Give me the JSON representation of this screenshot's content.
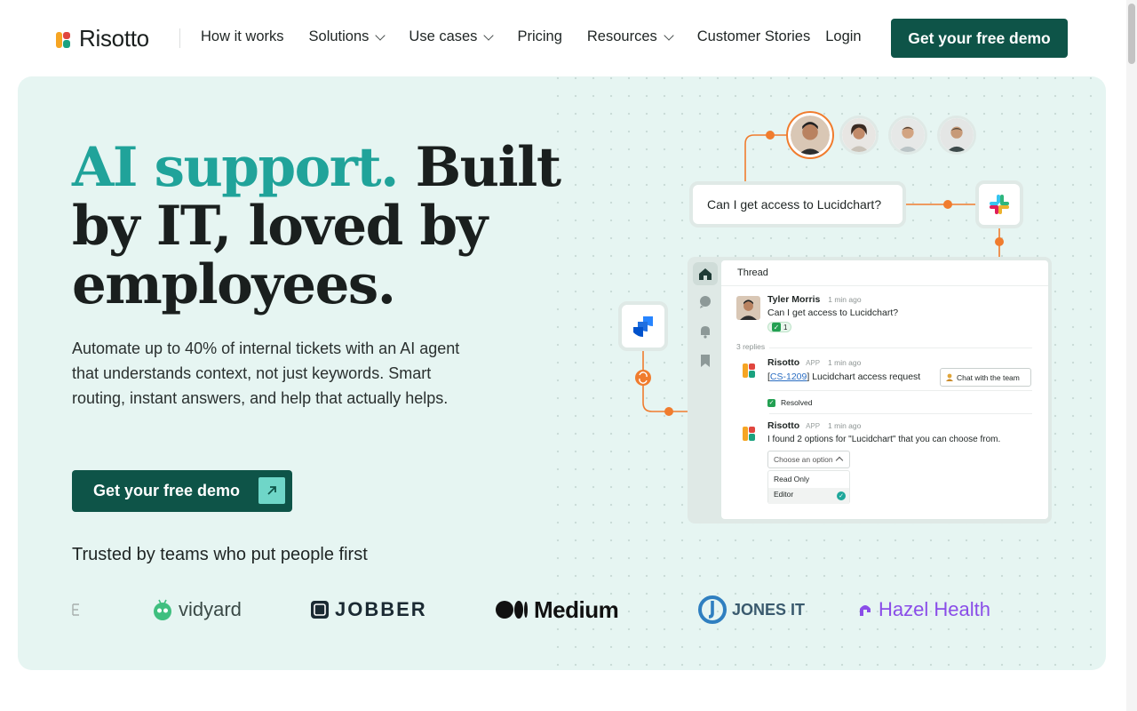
{
  "brand": {
    "name": "Risotto"
  },
  "nav": {
    "links": [
      {
        "label": "How it works",
        "dropdown": false
      },
      {
        "label": "Solutions",
        "dropdown": true
      },
      {
        "label": "Use cases",
        "dropdown": true
      },
      {
        "label": "Pricing",
        "dropdown": false
      },
      {
        "label": "Resources",
        "dropdown": true
      },
      {
        "label": "Customer Stories",
        "dropdown": false
      }
    ],
    "login": "Login",
    "cta": "Get your free demo"
  },
  "hero": {
    "headline_accent": "AI support.",
    "headline_rest": " Built by IT, loved by employees.",
    "subtext": "Automate up to 40% of internal tickets with an AI agent that understands context, not just keywords. Smart routing, instant answers, and help that actually helps.",
    "cta": "Get your free demo",
    "trusted": "Trusted by teams who put people first",
    "logos": [
      "vidyard",
      "JOBBER",
      "Medium",
      "JONES IT",
      "Hazel Health"
    ]
  },
  "illustration": {
    "question": "Can I get access to Lucidchart?",
    "thread": {
      "title": "Thread",
      "msg1": {
        "name": "Tyler Morris",
        "time": "1 min ago",
        "text": "Can I get access to Lucidchart?",
        "reaction_count": "1"
      },
      "replies": "3 replies",
      "msg2": {
        "name": "Risotto",
        "tag": "APP",
        "time": "1 min ago",
        "ticket": "CS-1209",
        "text": " Lucidchart access request",
        "button": "Chat with the team",
        "status": "Resolved"
      },
      "msg3": {
        "name": "Risotto",
        "tag": "APP",
        "time": "1 min ago",
        "text": "I found 2 options for \"Lucidchart\" that you can choose from.",
        "select": "Choose an option",
        "options": [
          "Read Only",
          "Editor"
        ]
      }
    }
  },
  "colors": {
    "primary": "#0e5448",
    "accent": "#20a39a",
    "hero_bg": "#e6f5f2",
    "connector": "#f07c2e"
  }
}
